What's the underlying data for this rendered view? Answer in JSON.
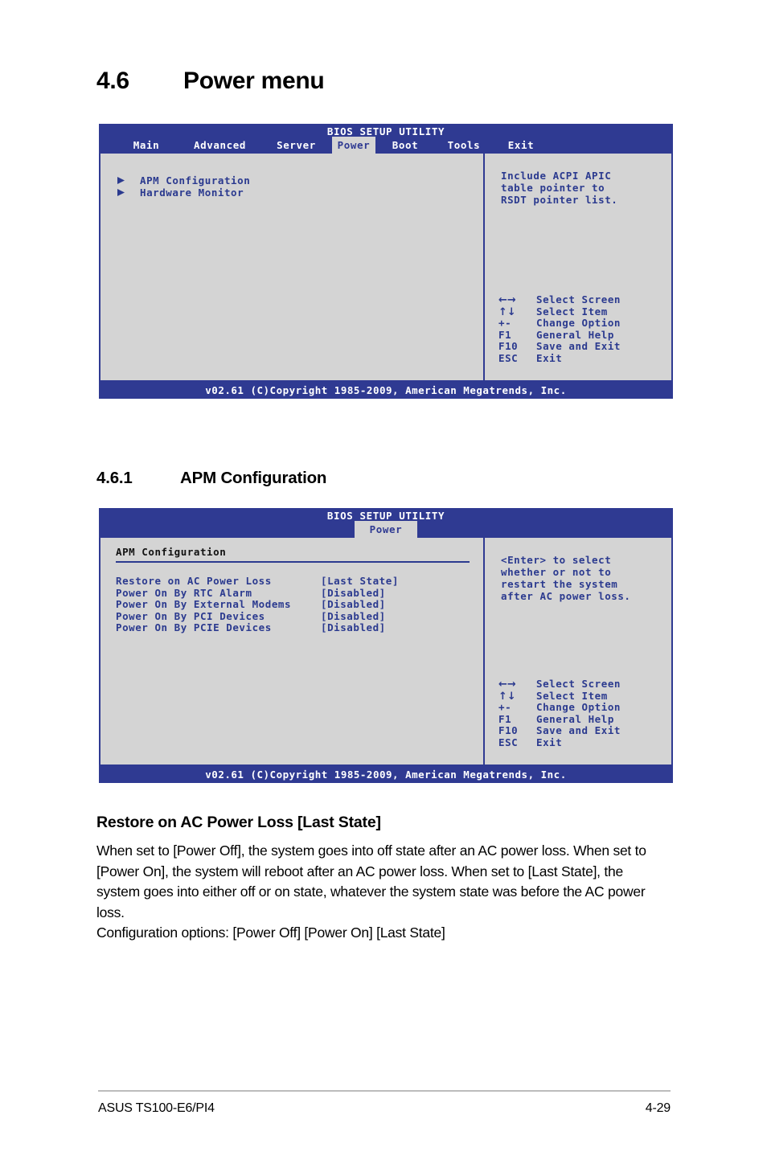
{
  "page": {
    "section_number": "4.6",
    "section_title": "Power menu",
    "subsection_number": "4.6.1",
    "subsection_title": "APM Configuration"
  },
  "bios_power": {
    "title": "BIOS SETUP UTILITY",
    "tabs": [
      {
        "label": "Main",
        "active": false
      },
      {
        "label": "Advanced",
        "active": false
      },
      {
        "label": "Server",
        "active": false
      },
      {
        "label": "Power",
        "active": true
      },
      {
        "label": "Boot",
        "active": false
      },
      {
        "label": "Tools",
        "active": false
      },
      {
        "label": "Exit",
        "active": false
      }
    ],
    "menu_items": [
      {
        "label": "APM Configuration",
        "icon": "triangle-right-icon"
      },
      {
        "label": "Hardware Monitor",
        "icon": "triangle-right-icon"
      }
    ],
    "help_lines": [
      "Include ACPI APIC",
      "table pointer to",
      "RSDT pointer list."
    ],
    "nav_help": [
      {
        "key": "←→",
        "action": "Select Screen"
      },
      {
        "key": "↑↓",
        "action": "Select Item"
      },
      {
        "key": "+-",
        "action": "Change Option"
      },
      {
        "key": "F1",
        "action": "General Help"
      },
      {
        "key": "F10",
        "action": "Save and Exit"
      },
      {
        "key": "ESC",
        "action": "Exit"
      }
    ],
    "footer": "v02.61 (C)Copyright 1985-2009, American Megatrends, Inc."
  },
  "bios_apm": {
    "title": "BIOS SETUP UTILITY",
    "tabs": [
      {
        "label": "Power",
        "active": true
      }
    ],
    "panel_title": "APM Configuration",
    "options": [
      {
        "label": "Restore on AC Power Loss",
        "value": "[Last State]"
      },
      {
        "label": "Power On By RTC Alarm",
        "value": "[Disabled]"
      },
      {
        "label": "Power On By External Modems",
        "value": "[Disabled]"
      },
      {
        "label": "Power On By PCI Devices",
        "value": "[Disabled]"
      },
      {
        "label": "Power On By PCIE Devices",
        "value": "[Disabled]"
      }
    ],
    "help_lines": [
      "<Enter> to select",
      "whether or not to",
      "restart the system",
      "after AC power loss."
    ],
    "nav_help": [
      {
        "key": "←→",
        "action": "Select Screen"
      },
      {
        "key": "↑↓",
        "action": "Select Item"
      },
      {
        "key": "+-",
        "action": "Change Option"
      },
      {
        "key": "F1",
        "action": "General Help"
      },
      {
        "key": "F10",
        "action": "Save and Exit"
      },
      {
        "key": "ESC",
        "action": "Exit"
      }
    ],
    "footer": "v02.61 (C)Copyright 1985-2009, American Megatrends, Inc."
  },
  "prose": {
    "heading": "Restore on AC Power Loss [Last State]",
    "paragraph": "When set to [Power Off], the system goes into off state after an AC power loss. When set to [Power On], the system will reboot after an AC power loss. When set to [Last State], the system goes into either off or on state, whatever the system state was before the AC power loss.",
    "config_options": "Configuration options: [Power Off] [Power On] [Last State]"
  },
  "page_footer": {
    "product": "ASUS TS100-E6/PI4",
    "page_number": "4-29"
  },
  "colors": {
    "bios_blue": "#2f3a92",
    "bios_text_blue": "#2b3a8f",
    "bios_panel_gray": "#d4d4d4"
  }
}
